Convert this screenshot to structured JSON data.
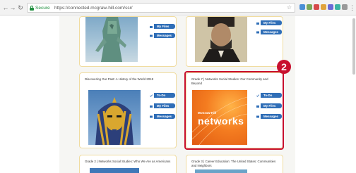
{
  "browser": {
    "secure_label": "Secure",
    "url": "https://connected.mcgraw-hill.com/ssr/",
    "star": "☆"
  },
  "cards": [
    {
      "title": "",
      "thumb": "statue-of-liberty",
      "buttons": [
        "My Files",
        "Messages"
      ]
    },
    {
      "title": "",
      "thumb": "lincoln-portrait",
      "buttons": [
        "My Files",
        "Messages"
      ]
    },
    {
      "title": "Discovering Our Past: A History of the World 2018",
      "thumb": "tutankhamun-mask",
      "buttons": [
        "To-Do",
        "My Files",
        "Messages"
      ]
    },
    {
      "title": "Grade 7 | Networks Social Studies: Our Community and Beyond",
      "thumb": "networks-cover",
      "buttons": [
        "To-Do",
        "My Files",
        "Messages"
      ]
    },
    {
      "title": "Grade 2 | Networks Social Studies: Who We Are as Americans",
      "thumb": "",
      "buttons": []
    },
    {
      "title": "Grade 3 | Career Education: The United States: Communities and Neighbors",
      "thumb": "",
      "buttons": []
    }
  ],
  "networks_cover": {
    "brand": "McGraw-Hill",
    "word": "networks"
  },
  "callout": {
    "number": "2"
  },
  "colors": {
    "accent_red": "#c8102e",
    "button_blue": "#2f6eb7",
    "card_border": "#f0dca0"
  }
}
